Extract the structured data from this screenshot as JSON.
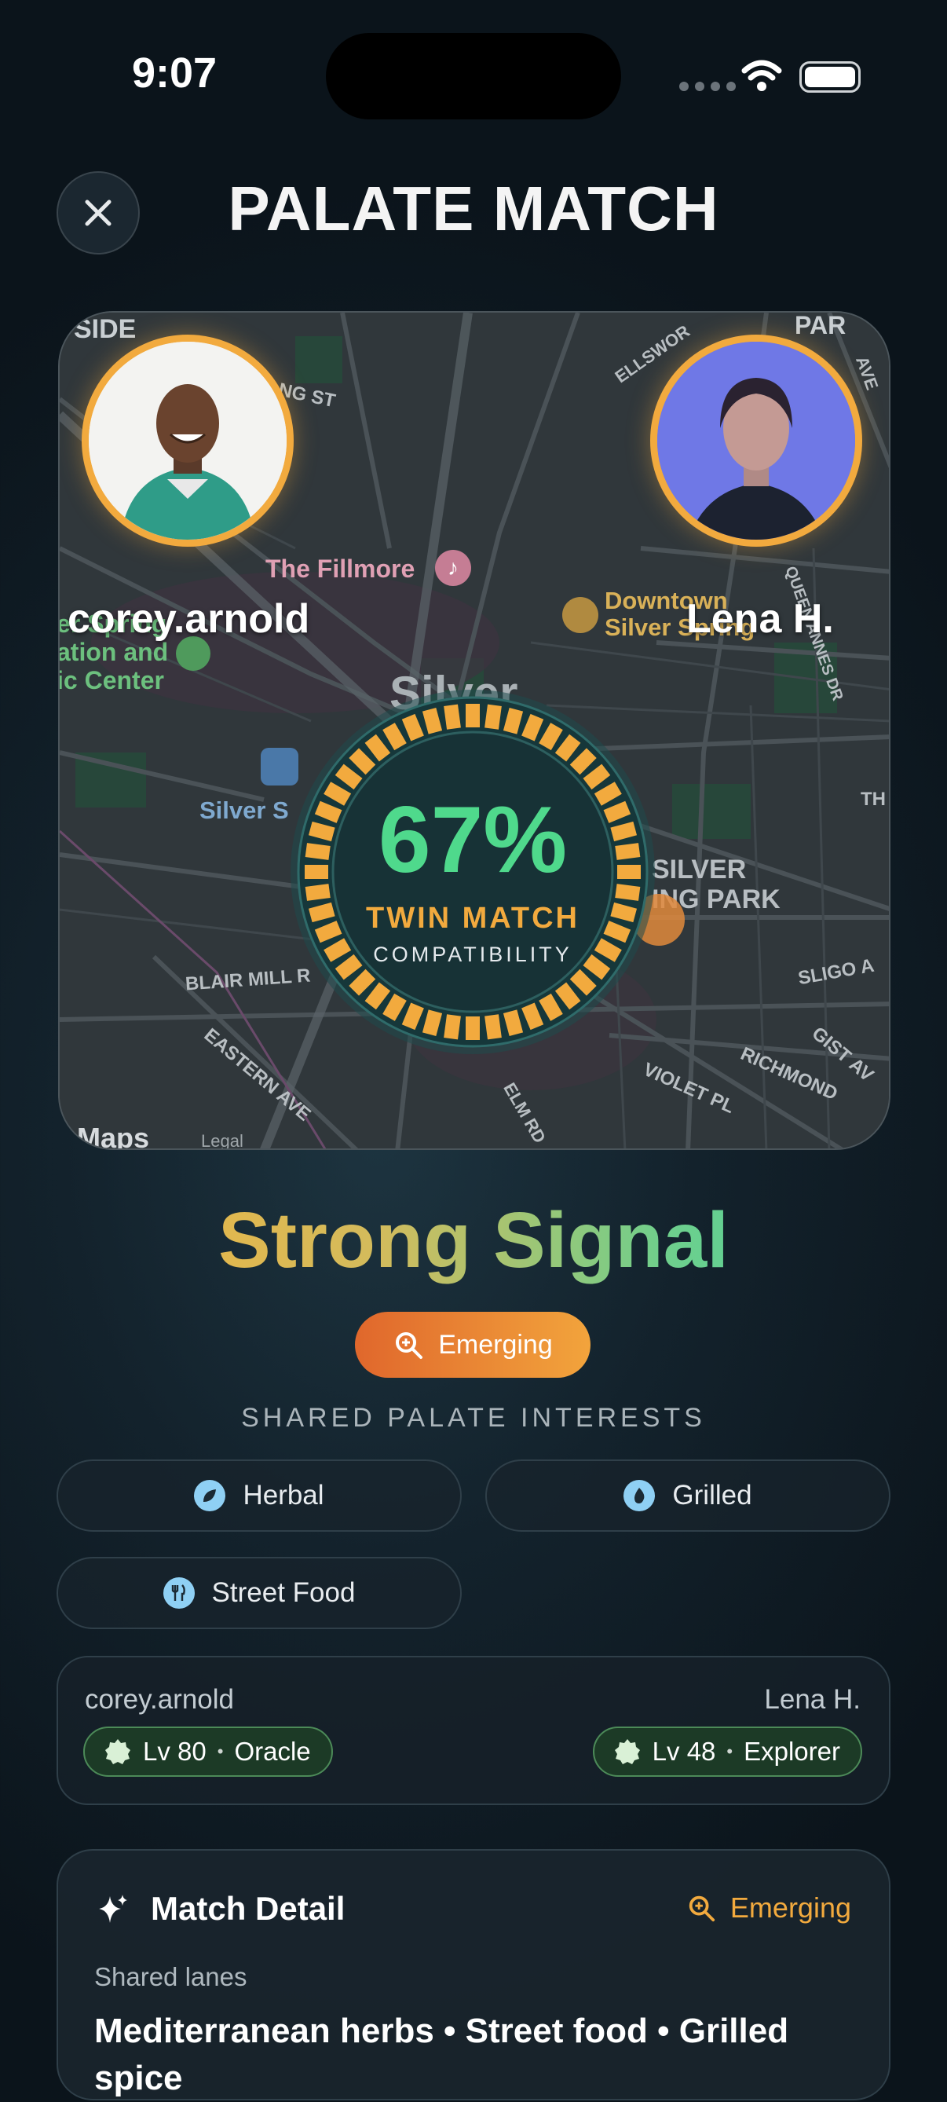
{
  "status_bar": {
    "time": "9:07"
  },
  "header": {
    "title": "PALATE MATCH",
    "close_icon": "close-icon"
  },
  "map": {
    "labels": {
      "side": "SIDE",
      "ng_st": "NG ST",
      "ellsworth": "ELLSWOR",
      "park": "PAR",
      "ave": "AVE",
      "queen_annes": "QUEEN ANNES DR",
      "fillmore": "The Fillmore",
      "downtown": "Downtown",
      "silver_spring": "Silver Spring",
      "rec1": "er Spring",
      "rec2": "ation and",
      "rec3": "ic Center",
      "silver_big": "Silver",
      "silver_s": "Silver S",
      "th": "TH",
      "silver_park1": "SILVER",
      "silver_park2": "ING PARK",
      "blair_mill": "BLAIR MILL R",
      "sligo": "SLIGO A",
      "eastern": "EASTERN AVE",
      "elm": "ELM RD",
      "violet": "VIOLET PL",
      "richmond": "RICHMOND",
      "gist": "GIST AV",
      "maps": "Maps",
      "legal": "Legal"
    }
  },
  "users": {
    "left": {
      "name": "corey.arnold"
    },
    "right": {
      "name": "Lena H."
    }
  },
  "gauge": {
    "percent": "67%",
    "value": 67,
    "label": "TWIN MATCH",
    "sublabel": "COMPATIBILITY"
  },
  "signal": {
    "title": "Strong Signal",
    "badge": "Emerging"
  },
  "shared": {
    "heading": "SHARED PALATE INTERESTS",
    "interests": [
      {
        "label": "Herbal",
        "icon": "leaf-icon"
      },
      {
        "label": "Grilled",
        "icon": "flame-icon"
      },
      {
        "label": "Street Food",
        "icon": "fork-knife-icon"
      }
    ]
  },
  "levels": {
    "left": {
      "name": "corey.arnold",
      "level": "Lv 80",
      "rank": "Oracle"
    },
    "right": {
      "name": "Lena H.",
      "level": "Lv 48",
      "rank": "Explorer"
    },
    "separator": "•"
  },
  "detail": {
    "title": "Match Detail",
    "badge": "Emerging",
    "lanes_label": "Shared lanes",
    "lanes": "Mediterranean herbs • Street food • Grilled spice"
  },
  "colors": {
    "accent_orange": "#f2aa3e",
    "accent_green": "#4fd98c",
    "level_green": "#4c8a58"
  }
}
